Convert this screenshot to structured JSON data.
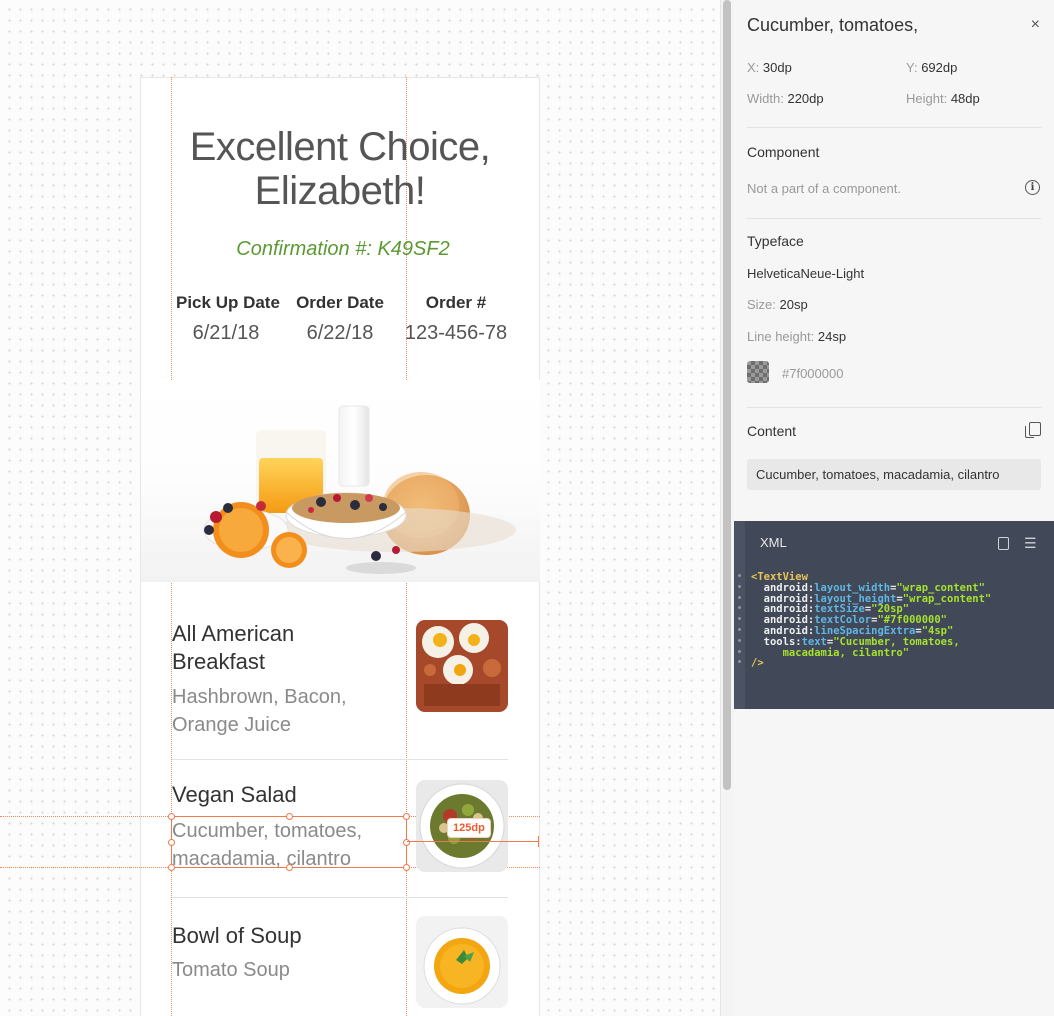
{
  "artboard": {
    "headline": [
      "Excellent Choice,",
      "Elizabeth!"
    ],
    "confirmation": "Confirmation #: K49SF2",
    "summary": [
      {
        "label": "Pick Up Date",
        "value": "6/21/18"
      },
      {
        "label": "Order Date",
        "value": "6/22/18"
      },
      {
        "label": "Order #",
        "value": "123-456-78"
      }
    ],
    "items": [
      {
        "title": [
          "All American",
          "Breakfast"
        ],
        "description": [
          "Hashbrown, Bacon,",
          "Orange Juice"
        ]
      },
      {
        "title": [
          "Vegan Salad"
        ],
        "description": [
          "Cucumber, tomatoes,",
          "macadamia, cilantro"
        ]
      },
      {
        "title": [
          "Bowl of Soup"
        ],
        "description": [
          "Tomato Soup"
        ]
      }
    ],
    "measurement": "125dp"
  },
  "inspector": {
    "title": "Cucumber, tomatoes,",
    "close_icon": "×",
    "x_label": "X:",
    "x_value": "30dp",
    "y_label": "Y:",
    "y_value": "692dp",
    "width_label": "Width:",
    "width_value": "220dp",
    "height_label": "Height:",
    "height_value": "48dp",
    "component_heading": "Component",
    "component_text": "Not a part of a component.",
    "info_icon": "i",
    "typeface_heading": "Typeface",
    "typeface_name": "HelveticaNeue-Light",
    "size_label": "Size:",
    "size_value": "20sp",
    "line_height_label": "Line height:",
    "line_height_value": "24sp",
    "color_value": "#7f000000",
    "content_heading": "Content",
    "content_value": "Cucumber, tomatoes, macadamia, cilantro",
    "xml_title": "XML",
    "xml_lines": [
      "<TextView",
      "  android:layout_width=\"wrap_content\"",
      "  android:layout_height=\"wrap_content\"",
      "  android:textSize=\"20sp\"",
      "  android:textColor=\"#7f000000\"",
      "  android:lineSpacingExtra=\"4sp\"",
      "  tools:text=\"Cucumber, tomatoes,",
      "     macadamia, cilantro\"",
      "/>"
    ]
  },
  "colors": {
    "accent": "#ef7a4e",
    "confirmation": "#5b9a32",
    "xml_bg": "#414858"
  }
}
